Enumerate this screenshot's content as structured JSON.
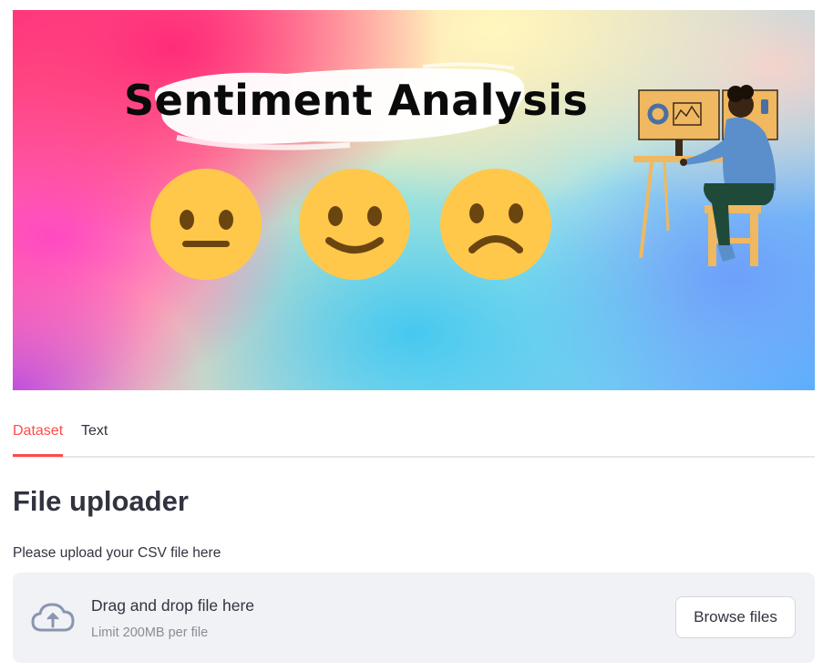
{
  "banner": {
    "title": "Sentiment Analysis",
    "faces": [
      "neutral-face-icon",
      "smiling-face-icon",
      "sad-face-icon"
    ],
    "colors": {
      "face": "#ffc84a",
      "face_features": "#6b4510",
      "desk": "#f0b860",
      "shirt": "#5b8fcc",
      "pants": "#1f4a3a"
    }
  },
  "tabs": [
    {
      "label": "Dataset",
      "active": true
    },
    {
      "label": "Text",
      "active": false
    }
  ],
  "accent_color": "#ff4b4b",
  "section": {
    "heading": "File uploader",
    "uploader_label": "Please upload your CSV file here"
  },
  "uploader": {
    "icon": "cloud-upload-icon",
    "title": "Drag and drop file here",
    "limit": "Limit 200MB per file",
    "button": "Browse files"
  }
}
